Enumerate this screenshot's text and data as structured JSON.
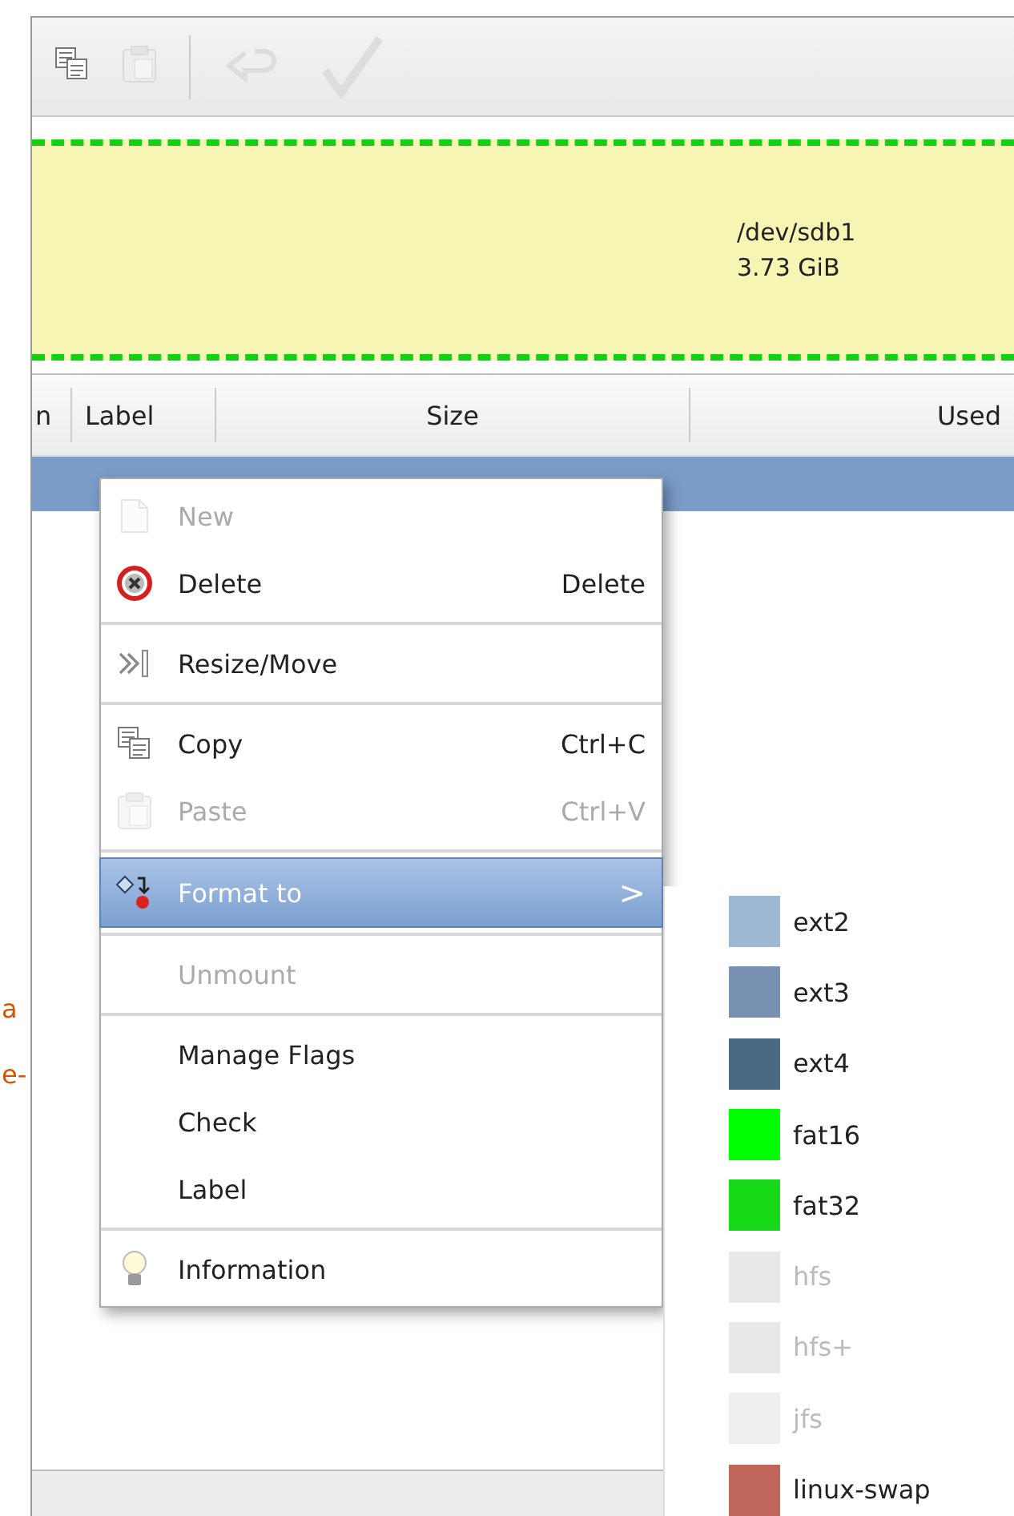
{
  "page_margin": {
    "fragments": [
      "a",
      "e-"
    ]
  },
  "partition_graph": {
    "device": "/dev/sdb1",
    "size": "3.73 GiB"
  },
  "table": {
    "columns": [
      "n",
      "Label",
      "Size",
      "Used"
    ],
    "rows": [
      {
        "selected": true
      }
    ]
  },
  "context_menu": {
    "items": [
      {
        "kind": "item",
        "label": "New",
        "disabled": true,
        "selected": false
      },
      {
        "kind": "item",
        "label": "Delete",
        "shortcut": "Delete",
        "disabled": false,
        "selected": false
      },
      {
        "kind": "separator"
      },
      {
        "kind": "item",
        "label": "Resize/Move",
        "disabled": false,
        "selected": false
      },
      {
        "kind": "separator"
      },
      {
        "kind": "item",
        "label": "Copy",
        "shortcut": "Ctrl+C",
        "disabled": false,
        "selected": false
      },
      {
        "kind": "item",
        "label": "Paste",
        "shortcut": "Ctrl+V",
        "disabled": true,
        "selected": false
      },
      {
        "kind": "separator"
      },
      {
        "kind": "submenu",
        "label": "Format to",
        "arrow": ">",
        "disabled": false,
        "selected": true
      },
      {
        "kind": "separator"
      },
      {
        "kind": "item",
        "label": "Unmount",
        "disabled": true,
        "selected": false
      },
      {
        "kind": "separator"
      },
      {
        "kind": "item",
        "label": "Manage Flags",
        "disabled": false,
        "selected": false
      },
      {
        "kind": "item",
        "label": "Check",
        "disabled": false,
        "selected": false
      },
      {
        "kind": "item",
        "label": "Label",
        "disabled": false,
        "selected": false
      },
      {
        "kind": "separator"
      },
      {
        "kind": "item",
        "label": "Information",
        "disabled": false,
        "selected": false
      }
    ]
  },
  "format_submenu": {
    "items": [
      {
        "label": "ext2",
        "color": "#9db8d2",
        "disabled": false
      },
      {
        "label": "ext3",
        "color": "#7891b3",
        "disabled": false
      },
      {
        "label": "ext4",
        "color": "#4b6983",
        "disabled": false
      },
      {
        "label": "fat16",
        "color": "#00ff00",
        "disabled": false
      },
      {
        "label": "fat32",
        "color": "#18d918",
        "disabled": false
      },
      {
        "label": "hfs",
        "color": "#e8e8e8",
        "disabled": true
      },
      {
        "label": "hfs+",
        "color": "#e8e8e8",
        "disabled": true
      },
      {
        "label": "jfs",
        "color": "#eeeeee",
        "disabled": true
      },
      {
        "label": "linux-swap",
        "color": "#c1665a",
        "disabled": false
      }
    ]
  }
}
